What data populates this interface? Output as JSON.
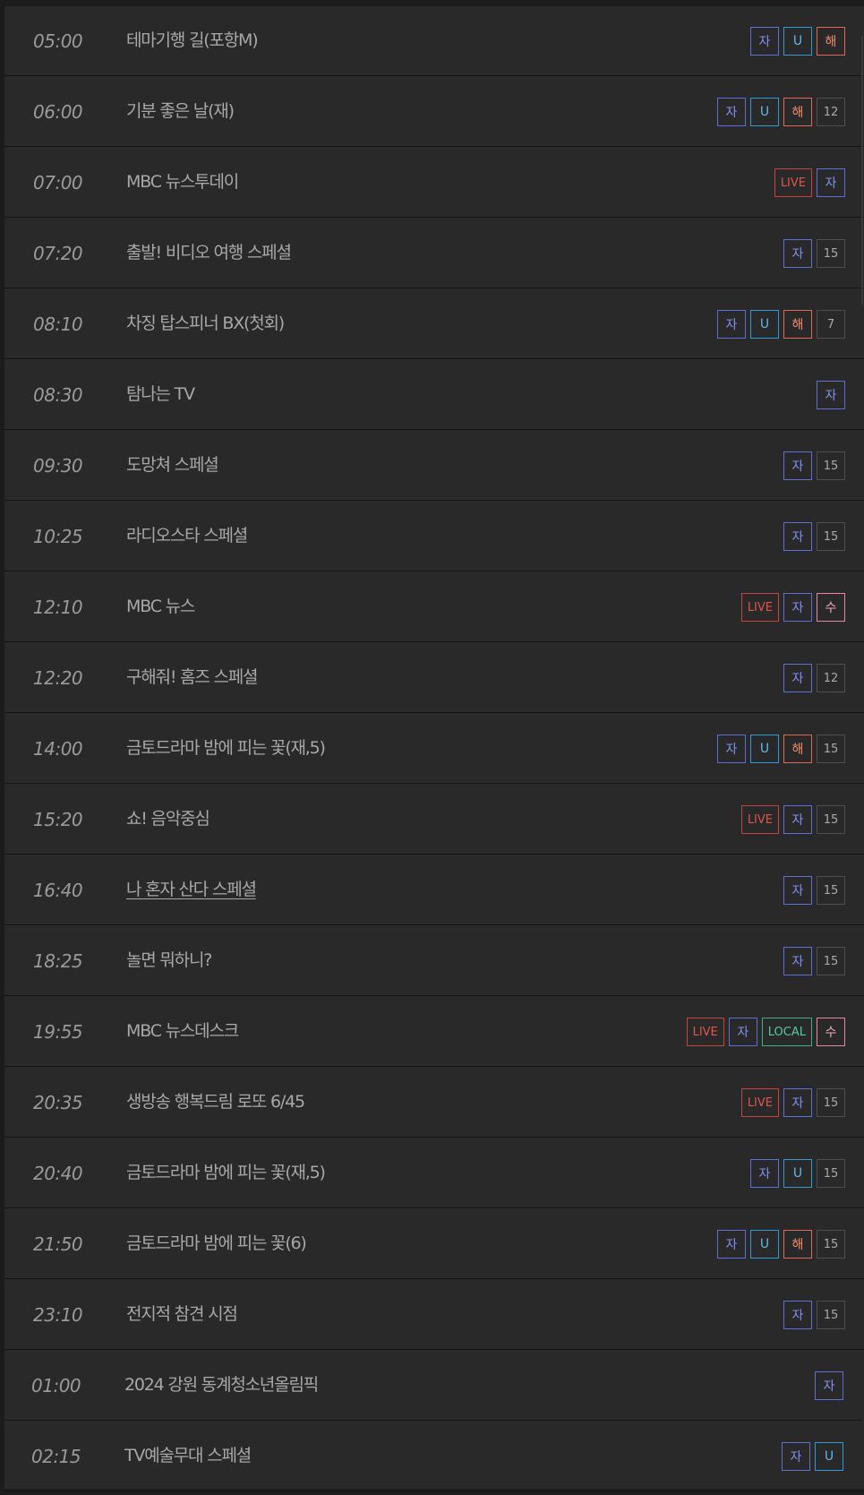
{
  "schedule": [
    {
      "time": "05:00",
      "title": "테마기행 길(포항M)",
      "badges": [
        {
          "kind": "ja",
          "label": "자"
        },
        {
          "kind": "u",
          "label": "U"
        },
        {
          "kind": "hae",
          "label": "해"
        }
      ]
    },
    {
      "time": "06:00",
      "title": "기분 좋은 날(재)",
      "badges": [
        {
          "kind": "ja",
          "label": "자"
        },
        {
          "kind": "u",
          "label": "U"
        },
        {
          "kind": "hae",
          "label": "해"
        },
        {
          "kind": "age",
          "label": "12"
        }
      ]
    },
    {
      "time": "07:00",
      "title": "MBC 뉴스투데이",
      "badges": [
        {
          "kind": "live",
          "label": "LIVE"
        },
        {
          "kind": "ja",
          "label": "자"
        }
      ]
    },
    {
      "time": "07:20",
      "title": "출발! 비디오 여행 스페셜",
      "badges": [
        {
          "kind": "ja",
          "label": "자"
        },
        {
          "kind": "age",
          "label": "15"
        }
      ]
    },
    {
      "time": "08:10",
      "title": "차징 탑스피너 BX(첫회)",
      "badges": [
        {
          "kind": "ja",
          "label": "자"
        },
        {
          "kind": "u",
          "label": "U"
        },
        {
          "kind": "hae",
          "label": "해"
        },
        {
          "kind": "age",
          "label": "7"
        }
      ]
    },
    {
      "time": "08:30",
      "title": "탐나는 TV",
      "badges": [
        {
          "kind": "ja",
          "label": "자"
        }
      ]
    },
    {
      "time": "09:30",
      "title": "도망쳐 스페셜",
      "badges": [
        {
          "kind": "ja",
          "label": "자"
        },
        {
          "kind": "age",
          "label": "15"
        }
      ]
    },
    {
      "time": "10:25",
      "title": "라디오스타 스페셜",
      "badges": [
        {
          "kind": "ja",
          "label": "자"
        },
        {
          "kind": "age",
          "label": "15"
        }
      ]
    },
    {
      "time": "12:10",
      "title": "MBC 뉴스",
      "badges": [
        {
          "kind": "live",
          "label": "LIVE"
        },
        {
          "kind": "ja",
          "label": "자"
        },
        {
          "kind": "su",
          "label": "수"
        }
      ]
    },
    {
      "time": "12:20",
      "title": "구해줘! 홈즈 스페셜",
      "badges": [
        {
          "kind": "ja",
          "label": "자"
        },
        {
          "kind": "age",
          "label": "12"
        }
      ]
    },
    {
      "time": "14:00",
      "title": "금토드라마 밤에 피는 꽃(재,5)",
      "badges": [
        {
          "kind": "ja",
          "label": "자"
        },
        {
          "kind": "u",
          "label": "U"
        },
        {
          "kind": "hae",
          "label": "해"
        },
        {
          "kind": "age",
          "label": "15"
        }
      ]
    },
    {
      "time": "15:20",
      "title": "쇼! 음악중심",
      "badges": [
        {
          "kind": "live",
          "label": "LIVE"
        },
        {
          "kind": "ja",
          "label": "자"
        },
        {
          "kind": "age",
          "label": "15"
        }
      ]
    },
    {
      "time": "16:40",
      "title": "나 혼자 산다 스페셜",
      "link": true,
      "badges": [
        {
          "kind": "ja",
          "label": "자"
        },
        {
          "kind": "age",
          "label": "15"
        }
      ]
    },
    {
      "time": "18:25",
      "title": "놀면 뭐하니?",
      "badges": [
        {
          "kind": "ja",
          "label": "자"
        },
        {
          "kind": "age",
          "label": "15"
        }
      ]
    },
    {
      "time": "19:55",
      "title": "MBC 뉴스데스크",
      "badges": [
        {
          "kind": "live",
          "label": "LIVE"
        },
        {
          "kind": "ja",
          "label": "자"
        },
        {
          "kind": "local",
          "label": "LOCAL"
        },
        {
          "kind": "su",
          "label": "수"
        }
      ]
    },
    {
      "time": "20:35",
      "title": "생방송 행복드림 로또 6/45",
      "badges": [
        {
          "kind": "live",
          "label": "LIVE"
        },
        {
          "kind": "ja",
          "label": "자"
        },
        {
          "kind": "age",
          "label": "15"
        }
      ]
    },
    {
      "time": "20:40",
      "title": "금토드라마 밤에 피는 꽃(재,5)",
      "badges": [
        {
          "kind": "ja",
          "label": "자"
        },
        {
          "kind": "u",
          "label": "U"
        },
        {
          "kind": "age",
          "label": "15"
        }
      ]
    },
    {
      "time": "21:50",
      "title": "금토드라마 밤에 피는 꽃(6)",
      "badges": [
        {
          "kind": "ja",
          "label": "자"
        },
        {
          "kind": "u",
          "label": "U"
        },
        {
          "kind": "hae",
          "label": "해"
        },
        {
          "kind": "age",
          "label": "15"
        }
      ]
    },
    {
      "time": "23:10",
      "title": "전지적 참견 시점",
      "badges": [
        {
          "kind": "ja",
          "label": "자"
        },
        {
          "kind": "age",
          "label": "15"
        }
      ]
    },
    {
      "time": "01:00",
      "title": "2024 강원 동계청소년올림픽",
      "badges": [
        {
          "kind": "ja",
          "label": "자"
        }
      ]
    },
    {
      "time": "02:15",
      "title": "TV예술무대 스페셜",
      "badges": [
        {
          "kind": "ja",
          "label": "자"
        },
        {
          "kind": "u",
          "label": "U"
        }
      ]
    }
  ]
}
